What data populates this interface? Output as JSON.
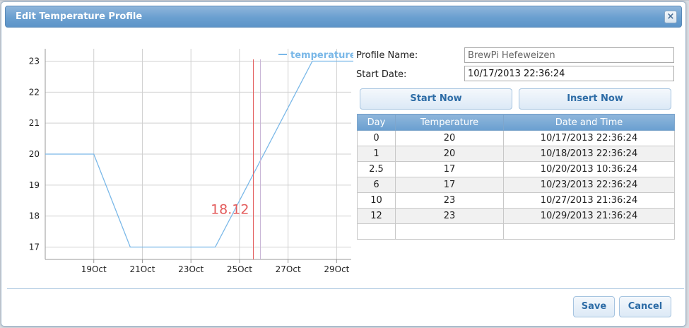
{
  "dialog": {
    "title": "Edit Temperature Profile",
    "close_symbol": "×"
  },
  "form": {
    "profile_name_label": "Profile Name:",
    "profile_name_value": "BrewPi Hefeweizen",
    "start_date_label": "Start Date:",
    "start_date_value": "10/17/2013 22:36:24",
    "start_now_label": "Start Now",
    "insert_now_label": "Insert Now"
  },
  "table": {
    "headers": [
      "Day",
      "Temperature",
      "Date and Time"
    ],
    "rows": [
      [
        "0",
        "20",
        "10/17/2013 22:36:24"
      ],
      [
        "1",
        "20",
        "10/18/2013 22:36:24"
      ],
      [
        "2.5",
        "17",
        "10/20/2013 10:36:24"
      ],
      [
        "6",
        "17",
        "10/23/2013 22:36:24"
      ],
      [
        "10",
        "23",
        "10/27/2013 21:36:24"
      ],
      [
        "12",
        "23",
        "10/29/2013 21:36:24"
      ],
      [
        "",
        "",
        ""
      ]
    ]
  },
  "footer": {
    "save_label": "Save",
    "cancel_label": "Cancel"
  },
  "colors": {
    "series": "#7ab8e8",
    "now_marker": "#e35b5b",
    "accent": "#6a9fd0"
  },
  "chart_data": {
    "type": "line",
    "legend": "temperature",
    "legend_position": "top-right",
    "x_tick_labels": [
      "19Oct",
      "21Oct",
      "23Oct",
      "25Oct",
      "27Oct",
      "29Oct"
    ],
    "y_tick_labels": [
      "17",
      "18",
      "19",
      "20",
      "21",
      "22",
      "23"
    ],
    "ylim": [
      16.6,
      23.4
    ],
    "grid": true,
    "series": [
      {
        "name": "temperature",
        "x_days": [
          -1,
          0,
          1,
          2.5,
          6,
          10,
          12,
          13
        ],
        "values": [
          20,
          20,
          20,
          17,
          17,
          23,
          23,
          23
        ]
      }
    ],
    "now_marker": {
      "x_day": 7.57,
      "label": "18.12"
    }
  }
}
